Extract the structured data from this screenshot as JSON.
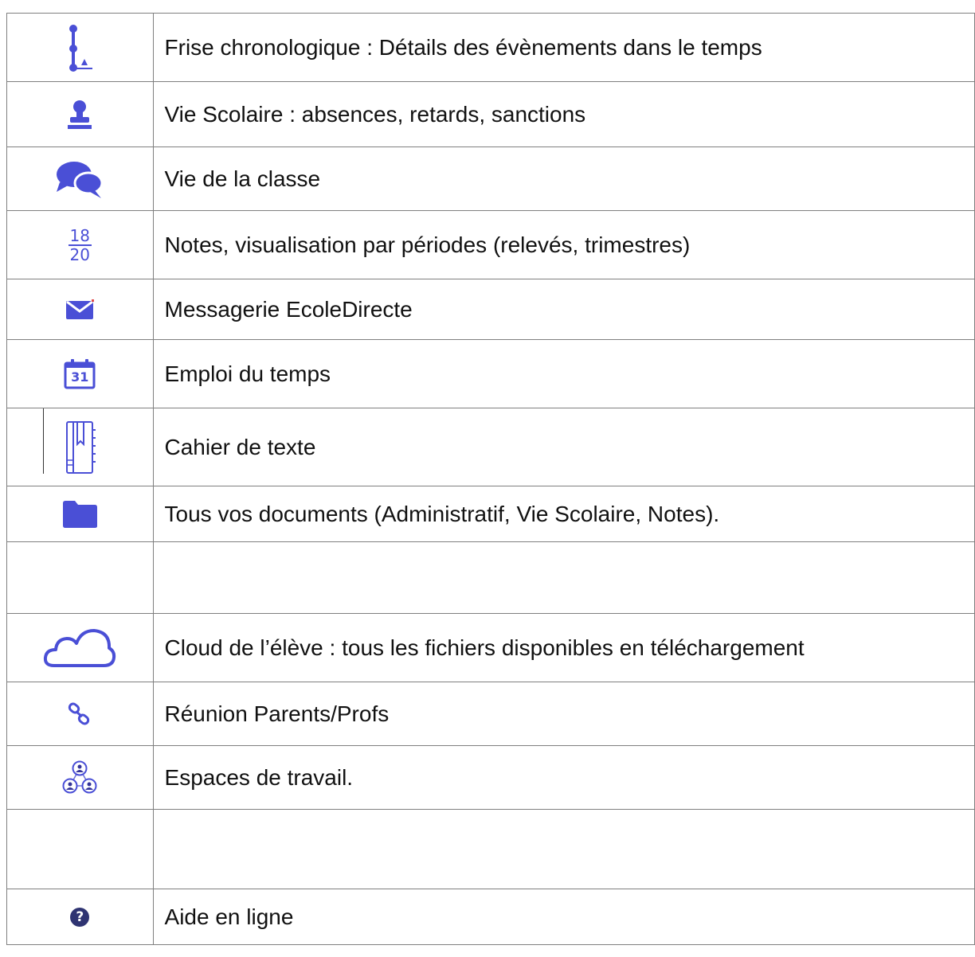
{
  "rows": [
    {
      "icon": "timeline-icon",
      "label": "Frise chronologique : Détails des évènements dans le temps"
    },
    {
      "icon": "stamp-icon",
      "label": "Vie Scolaire : absences, retards, sanctions"
    },
    {
      "icon": "chat-bubbles-icon",
      "label": "Vie de la classe"
    },
    {
      "icon": "grades-fraction-icon",
      "label": "Notes, visualisation par périodes (relevés, trimestres)",
      "fraction": {
        "numerator": "18",
        "denominator": "20"
      }
    },
    {
      "icon": "envelope-icon",
      "label": "Messagerie EcoleDirecte"
    },
    {
      "icon": "calendar-icon",
      "label": "Emploi du temps",
      "calendar_day": "31"
    },
    {
      "icon": "notebook-icon",
      "label": "Cahier de texte"
    },
    {
      "icon": "folder-icon",
      "label": "Tous vos documents (Administratif, Vie Scolaire, Notes)."
    },
    {
      "icon": "",
      "label": ""
    },
    {
      "icon": "cloud-icon",
      "label": "Cloud de l’élève : tous les fichiers disponibles en téléchargement"
    },
    {
      "icon": "link-icon",
      "label": "Réunion Parents/Profs"
    },
    {
      "icon": "group-workspace-icon",
      "label": "Espaces de travail."
    },
    {
      "icon": "",
      "label": ""
    },
    {
      "icon": "help-icon",
      "label": "Aide en ligne",
      "glyph": "?"
    }
  ],
  "colors": {
    "icon_accent": "#4a4fd6",
    "border": "#7f7f7f",
    "text": "#111111"
  }
}
